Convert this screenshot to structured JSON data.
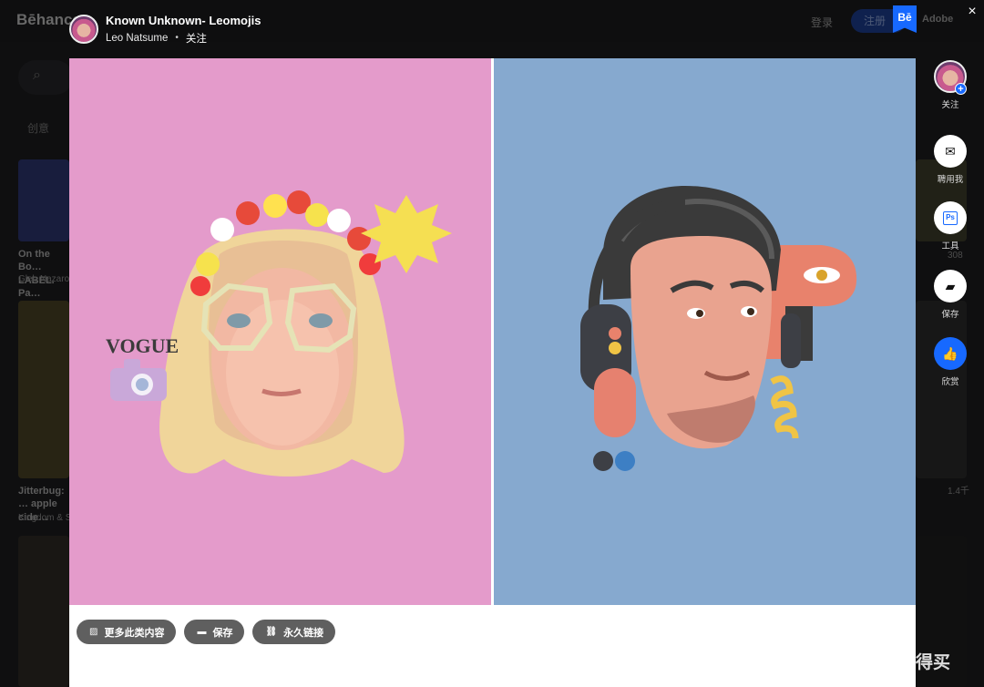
{
  "background": {
    "logo": "Bēhance",
    "login": "登录",
    "signup": "注册",
    "adobe": "Adobe",
    "tag": "创意",
    "card1_title": "On the Bo… LABEL. Pa…",
    "card1_author": "Gleb Nazaro…",
    "card2_title": "Jitterbug: … apple cide…",
    "card2_author": "Kingdom & S…",
    "stat_a": "308",
    "stat_b": "1.4千"
  },
  "header": {
    "title": "Known Unknown- Leomojis",
    "author": "Leo Natsume",
    "separator": "•",
    "follow": "关注",
    "close": "×",
    "be_badge": "Bē"
  },
  "artwork": {
    "left_bg": "#e49bcb",
    "right_bg": "#86a9cf",
    "vogue_text": "VOGUE"
  },
  "actions": {
    "more": "更多此类内容",
    "save": "保存",
    "permalink": "永久链接"
  },
  "sidebar": {
    "follow": "关注",
    "hire": "聘用我",
    "tools": "工具",
    "tools_icon_text": "Ps",
    "save": "保存",
    "appreciate": "欣赏"
  },
  "watermark": {
    "text": "什么值得买",
    "symbol": "值"
  },
  "colors": {
    "accent": "#1769ff"
  }
}
